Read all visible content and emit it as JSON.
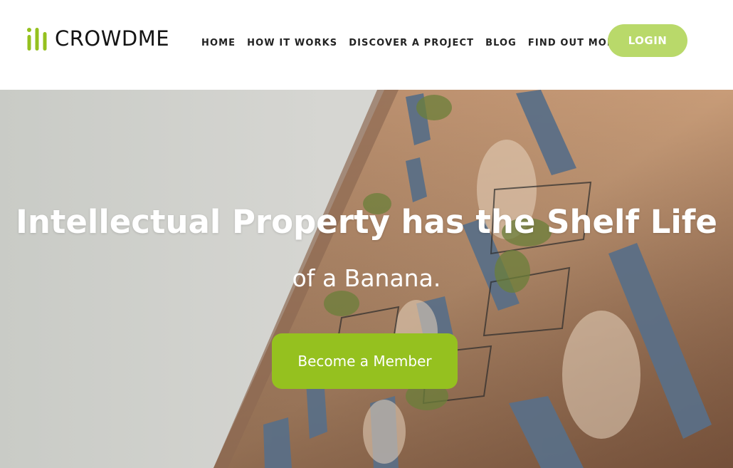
{
  "brand": {
    "name": "CROWDME",
    "accent_color": "#95c11f",
    "logo_icon": "bar-chart-logo-icon"
  },
  "nav": {
    "items": [
      {
        "label": "HOME"
      },
      {
        "label": "HOW IT WORKS"
      },
      {
        "label": "DISCOVER A PROJECT"
      },
      {
        "label": "BLOG"
      },
      {
        "label": "FIND OUT MORE"
      }
    ],
    "login_label": "LOGIN",
    "login_color": "#b9d96a"
  },
  "hero": {
    "title": "Intellectual Property has the Shelf Life",
    "subtitle": "of a Banana.",
    "cta_label": "Become a Member",
    "background": "building-facade-photo"
  }
}
